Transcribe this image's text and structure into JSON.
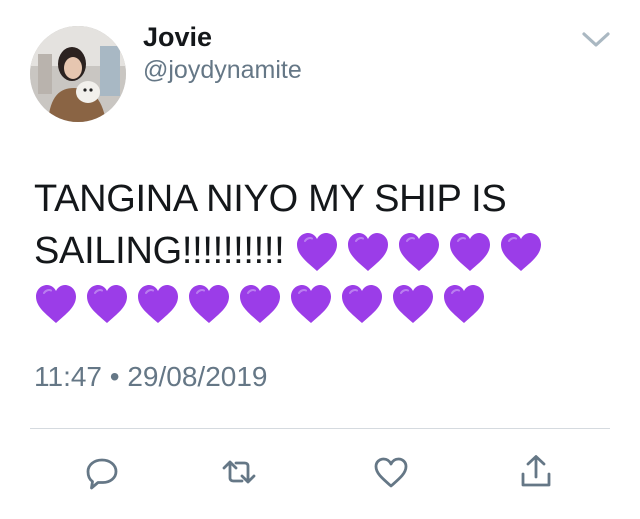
{
  "user": {
    "display_name": "Jovie",
    "handle": "@joydynamite",
    "avatar_icon": "profile-photo"
  },
  "tweet": {
    "text": "TANGINA NIYO MY SHIP IS SAILING!!!!!!!!!! ",
    "heart_count": 14,
    "heart_color": "#9b3de8",
    "timestamp": "11:47 • 29/08/2019"
  },
  "actions": {
    "reply_icon": "reply-icon",
    "retweet_icon": "retweet-icon",
    "like_icon": "heart-icon",
    "share_icon": "share-icon"
  },
  "colors": {
    "text": "#14171a",
    "secondary": "#657786",
    "icon": "#657786",
    "divider": "#d5dadf"
  }
}
